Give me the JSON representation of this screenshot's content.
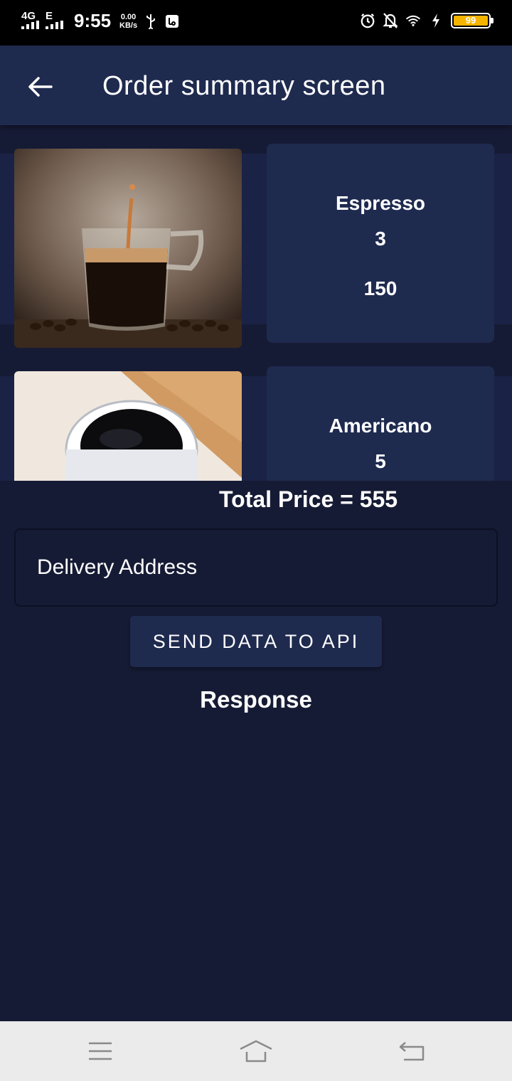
{
  "status_bar": {
    "network_type": "4G",
    "network_type_2": "E",
    "time": "9:55",
    "speed_value": "0.00",
    "speed_unit": "KB/s",
    "battery_level": "99",
    "icons": [
      "signal-icon",
      "usb-icon",
      "vpn-icon",
      "alarm-icon",
      "mute-icon",
      "wifi-icon",
      "charging-icon",
      "battery-icon"
    ]
  },
  "app_bar": {
    "title": "Order summary screen",
    "back_icon": "arrow-left-icon"
  },
  "orders": [
    {
      "name": "Espresso",
      "quantity": "3",
      "price": "150",
      "image": "espresso-cup-image"
    },
    {
      "name": "Americano",
      "quantity": "5",
      "price": "",
      "image": "americano-cup-image"
    }
  ],
  "total": {
    "label": "Total Price = 555"
  },
  "address": {
    "placeholder": "Delivery Address",
    "value": ""
  },
  "send_button": {
    "label": "SEND DATA TO API"
  },
  "response": {
    "label": "Response"
  },
  "nav_bar": {
    "icons": [
      "menu-icon",
      "home-icon",
      "back-icon"
    ]
  },
  "colors": {
    "background": "#161b35",
    "surface": "#1f2a4f",
    "battery": "#f5b400"
  }
}
